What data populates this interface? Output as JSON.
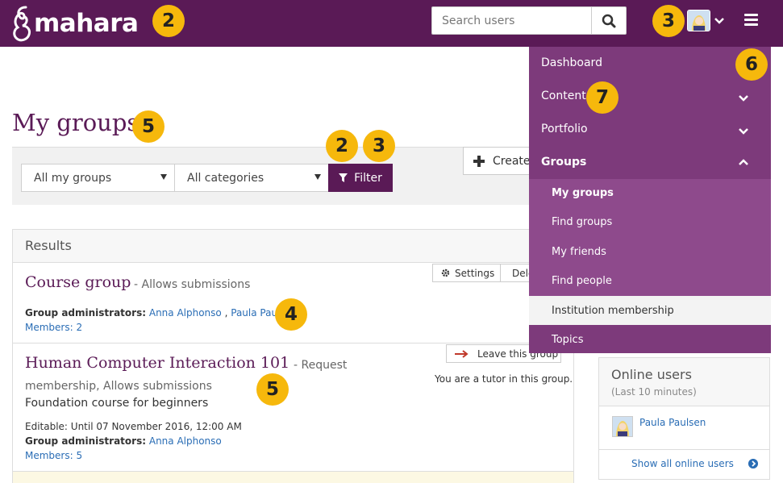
{
  "header": {
    "logo_text": "mahara",
    "search_placeholder": "Search users"
  },
  "badges": {
    "header_logo": "2",
    "user_menu": "3",
    "page_title": "5",
    "filter_a": "2",
    "filter_b": "3",
    "admins": "4",
    "group_desc": "5",
    "nav_dashboard": "6",
    "nav_content": "7"
  },
  "page": {
    "title": "My groups"
  },
  "filter": {
    "groups_select": "All my groups",
    "categories_select": "All categories",
    "filter_label": "Filter",
    "create_label": "Create"
  },
  "results": {
    "title": "Results",
    "groups": [
      {
        "name": "Course group",
        "type": "- Allows submissions",
        "admins_label": "Group administrators:",
        "admin_1": "Anna Alphonso",
        "admin_sep": ",",
        "admin_2": "Paula Paulsen",
        "members": "Members: 2",
        "settings_label": "Settings",
        "delete_label": "Delete"
      },
      {
        "name": "Human Computer Interaction 101",
        "type_1": "- Request",
        "type_2": "membership, Allows submissions",
        "description": "Foundation course for beginners",
        "editable": "Editable: Until 07 November 2016, 12:00 AM",
        "admins_label": "Group administrators:",
        "admin_1": "Anna Alphonso",
        "members": "Members: 5",
        "leave_label": "Leave this group",
        "tutor_note": "You are a tutor in this group."
      }
    ]
  },
  "online": {
    "title": "Online users",
    "subtitle": "(Last 10 minutes)",
    "user": "Paula Paulsen",
    "show_all": "Show all online users"
  },
  "nav": {
    "dashboard": "Dashboard",
    "content": "Content",
    "portfolio": "Portfolio",
    "groups": "Groups",
    "sub": [
      "My groups",
      "Find groups",
      "My friends",
      "Find people",
      "Institution membership",
      "Topics"
    ]
  },
  "colors": {
    "brand": "#5a1a56",
    "nav_bg": "#7d3a7b",
    "badge": "#f6b80c",
    "link": "#2a6db5"
  }
}
